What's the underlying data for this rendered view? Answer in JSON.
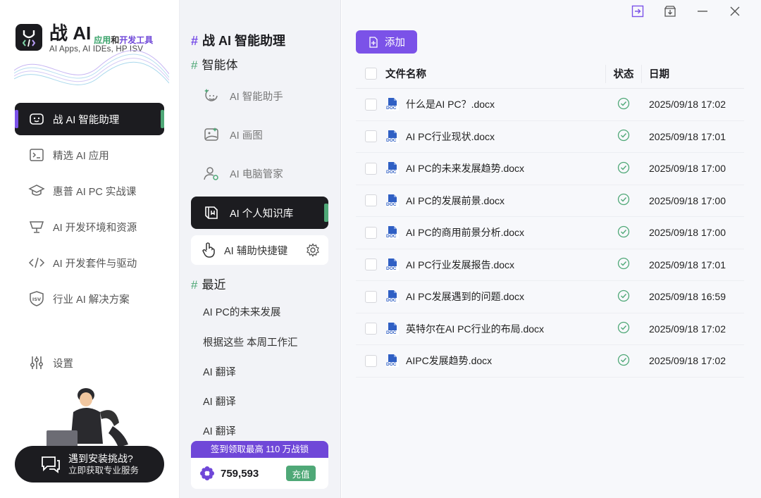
{
  "app": {
    "brand_name": "战 AI",
    "brand_tag_a": "应用",
    "brand_tag_b": "和",
    "brand_tag_c": "开发工具",
    "brand_sub": "AI Apps, AI IDEs, HP ISV"
  },
  "sidebar": {
    "items": [
      {
        "label": "战 AI 智能助理",
        "icon": "robot-face-icon",
        "active": true
      },
      {
        "label": "精选 AI 应用",
        "icon": "terminal-icon"
      },
      {
        "label": "惠普 AI PC 实战课",
        "icon": "graduation-cap-icon"
      },
      {
        "label": "AI 开发环境和资源",
        "icon": "monitor-icon"
      },
      {
        "label": "AI 开发套件与驱动",
        "icon": "code-icon"
      },
      {
        "label": "行业 AI 解决方案",
        "icon": "isv-shield-icon"
      }
    ],
    "settings_label": "设置",
    "help_title": "遇到安装挑战?",
    "help_sub": "立即获取专业服务"
  },
  "middle": {
    "hash": "#",
    "title": "战 AI 智能助理",
    "agents_heading": "智能体",
    "agents": [
      {
        "label": "AI 智能助手",
        "icon": "ai-face-icon"
      },
      {
        "label": "AI 画图",
        "icon": "image-icon"
      },
      {
        "label": "AI 电脑管家",
        "icon": "user-gear-icon"
      },
      {
        "label": "AI 个人知识库",
        "icon": "book-icon",
        "active": true
      },
      {
        "label": "AI 辅助快捷键",
        "icon": "hand-pointer-icon"
      }
    ],
    "recent_heading": "最近",
    "recent": [
      "AI PC的未来发展",
      "根据这些 本周工作汇",
      "AI 翻译",
      "AI 翻译",
      "AI 翻译"
    ],
    "promo_text": "签到领取最高 110 万战锁",
    "points": "759,593",
    "recharge_label": "充值"
  },
  "main": {
    "add_label": "添加",
    "columns": {
      "name": "文件名称",
      "status": "状态",
      "date": "日期"
    },
    "files": [
      {
        "name": "什么是AI PC？.docx",
        "date": "2025/09/18 17:02"
      },
      {
        "name": "AI PC行业现状.docx",
        "date": "2025/09/18 17:01"
      },
      {
        "name": "AI PC的未来发展趋势.docx",
        "date": "2025/09/18 17:00"
      },
      {
        "name": "AI PC的发展前景.docx",
        "date": "2025/09/18 17:00"
      },
      {
        "name": "AI PC的商用前景分析.docx",
        "date": "2025/09/18 17:00"
      },
      {
        "name": "AI PC行业发展报告.docx",
        "date": "2025/09/18 17:01"
      },
      {
        "name": "AI PC发展遇到的问题.docx",
        "date": "2025/09/18 16:59"
      },
      {
        "name": "英特尔在AI PC行业的布局.docx",
        "date": "2025/09/18 17:02"
      },
      {
        "name": "AIPC发展趋势.docx",
        "date": "2025/09/18 17:02"
      }
    ],
    "doc_badge": "DOC"
  },
  "colors": {
    "accent": "#7b52e8",
    "green": "#4fa877",
    "dark": "#1c1c20"
  }
}
